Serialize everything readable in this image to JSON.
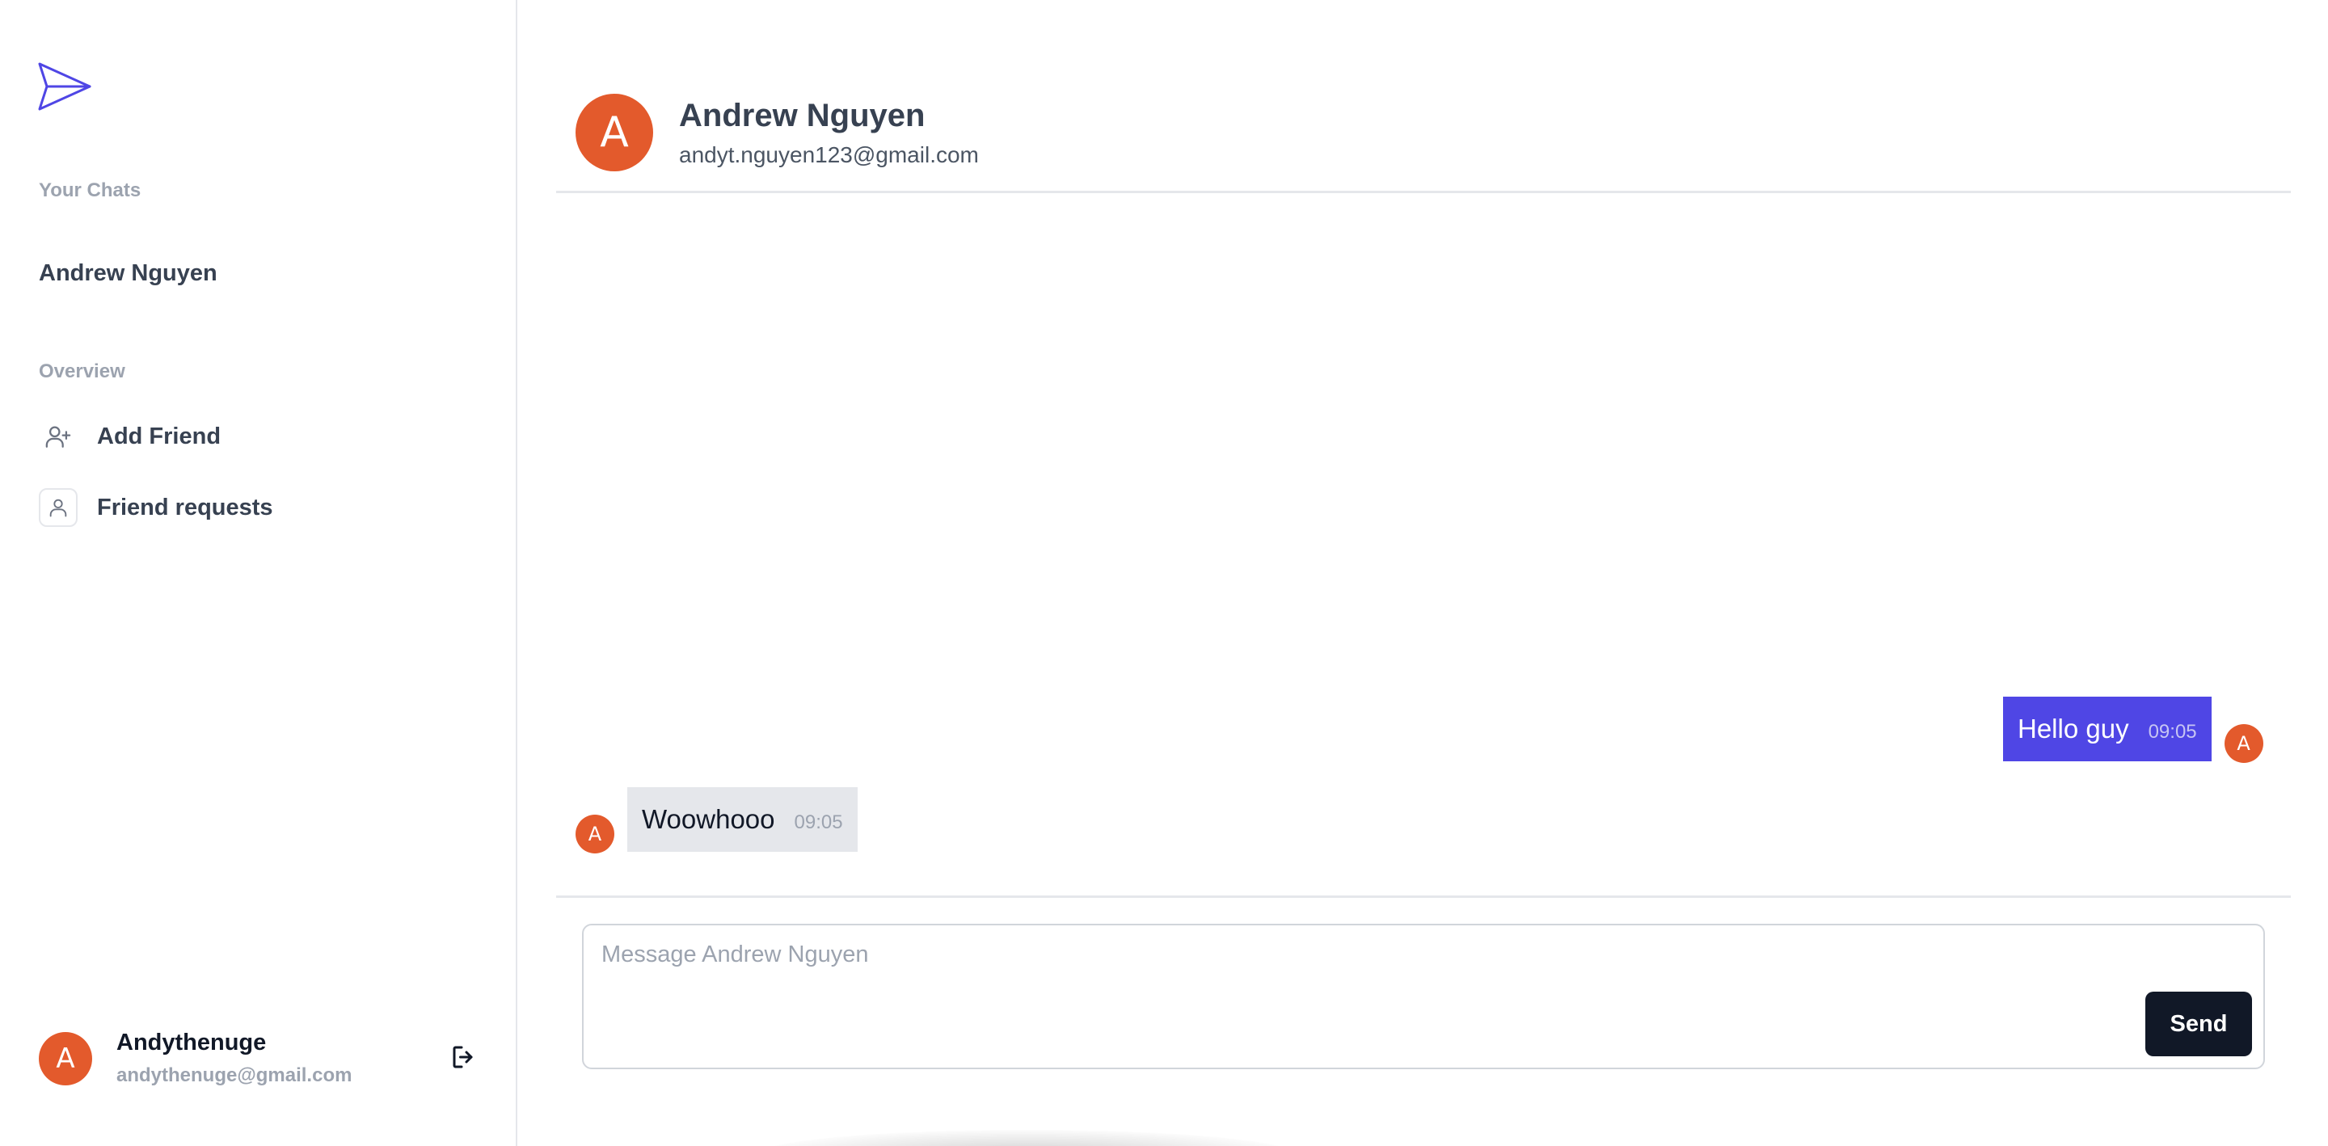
{
  "sidebar": {
    "logo_icon": "send-paper-plane-icon",
    "your_chats_label": "Your Chats",
    "chats": [
      {
        "name": "Andrew Nguyen"
      }
    ],
    "overview_label": "Overview",
    "nav": [
      {
        "label": "Add Friend",
        "icon": "user-plus-icon"
      },
      {
        "label": "Friend requests",
        "icon": "user-icon"
      }
    ],
    "user": {
      "initial": "A",
      "name": "Andythenuge",
      "email": "andythenuge@gmail.com"
    },
    "logout_icon": "logout-icon"
  },
  "chat": {
    "partner": {
      "initial": "A",
      "name": "Andrew Nguyen",
      "email": "andyt.nguyen123@gmail.com"
    },
    "messages": [
      {
        "direction": "sent",
        "text": "Hello guy",
        "time": "09:05",
        "initial": "A"
      },
      {
        "direction": "received",
        "text": "Woowhooo",
        "time": "09:05",
        "initial": "A"
      }
    ]
  },
  "composer": {
    "placeholder": "Message Andrew Nguyen",
    "value": "",
    "send_label": "Send"
  },
  "colors": {
    "accent": "#4f46e5",
    "avatar": "#e35a2c",
    "send_button": "#111827",
    "received_bubble": "#e5e7eb"
  }
}
